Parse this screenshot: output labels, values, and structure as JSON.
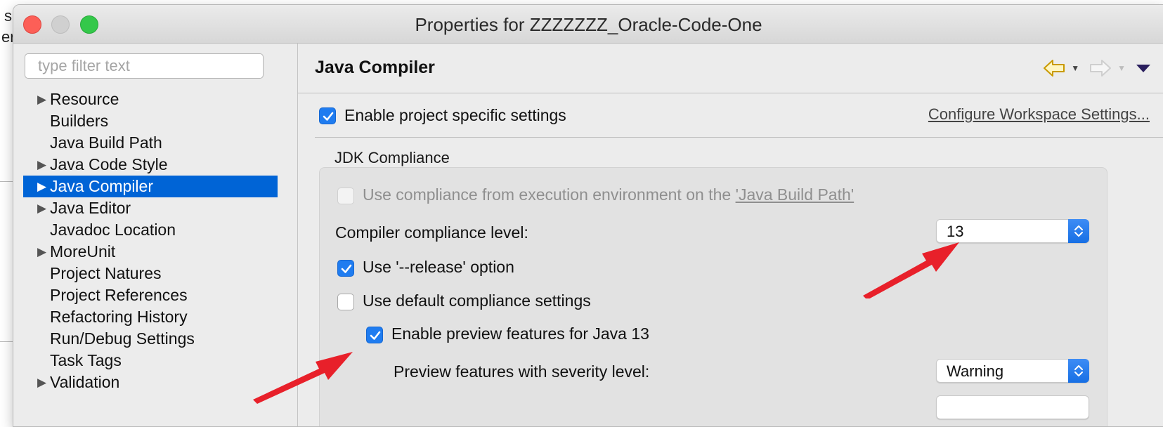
{
  "background": {
    "fragments": [
      "s",
      "er"
    ]
  },
  "window": {
    "title": "Properties for ZZZZZZZ_Oracle-Code-One"
  },
  "filter": {
    "placeholder": "type filter text",
    "value": ""
  },
  "nav": {
    "items": [
      {
        "label": "Resource",
        "expandable": true,
        "selected": false
      },
      {
        "label": "Builders",
        "expandable": false,
        "selected": false
      },
      {
        "label": "Java Build Path",
        "expandable": false,
        "selected": false
      },
      {
        "label": "Java Code Style",
        "expandable": true,
        "selected": false
      },
      {
        "label": "Java Compiler",
        "expandable": true,
        "selected": true
      },
      {
        "label": "Java Editor",
        "expandable": true,
        "selected": false
      },
      {
        "label": "Javadoc Location",
        "expandable": false,
        "selected": false
      },
      {
        "label": "MoreUnit",
        "expandable": true,
        "selected": false
      },
      {
        "label": "Project Natures",
        "expandable": false,
        "selected": false
      },
      {
        "label": "Project References",
        "expandable": false,
        "selected": false
      },
      {
        "label": "Refactoring History",
        "expandable": false,
        "selected": false
      },
      {
        "label": "Run/Debug Settings",
        "expandable": false,
        "selected": false
      },
      {
        "label": "Task Tags",
        "expandable": false,
        "selected": false
      },
      {
        "label": "Validation",
        "expandable": true,
        "selected": false
      }
    ]
  },
  "page": {
    "title": "Java Compiler",
    "enable_specific": {
      "label": "Enable project specific settings",
      "checked": true
    },
    "configure_link": "Configure Workspace Settings...",
    "group_label": "JDK Compliance",
    "use_env": {
      "prefix": "Use compliance from execution environment on the ",
      "link": "'Java Build Path'",
      "checked": false,
      "enabled": false
    },
    "compliance_label": "Compiler compliance level:",
    "compliance_value": "13",
    "release_option": {
      "label": "Use '--release' option",
      "checked": true
    },
    "default_settings": {
      "label": "Use default compliance settings",
      "checked": false
    },
    "preview_features": {
      "label": "Enable preview features for Java 13",
      "checked": true
    },
    "severity_label": "Preview features with severity level:",
    "severity_value": "Warning"
  },
  "icons": {
    "back": "back-arrow-icon",
    "forward": "forward-arrow-icon",
    "menu": "view-menu-icon",
    "annotation_arrow": "red-annotation-arrow"
  },
  "colors": {
    "selection": "#0064d6",
    "checkbox_on": "#1f7cf0",
    "annotation": "#e8202a",
    "back_arrow": "#e5b800"
  }
}
